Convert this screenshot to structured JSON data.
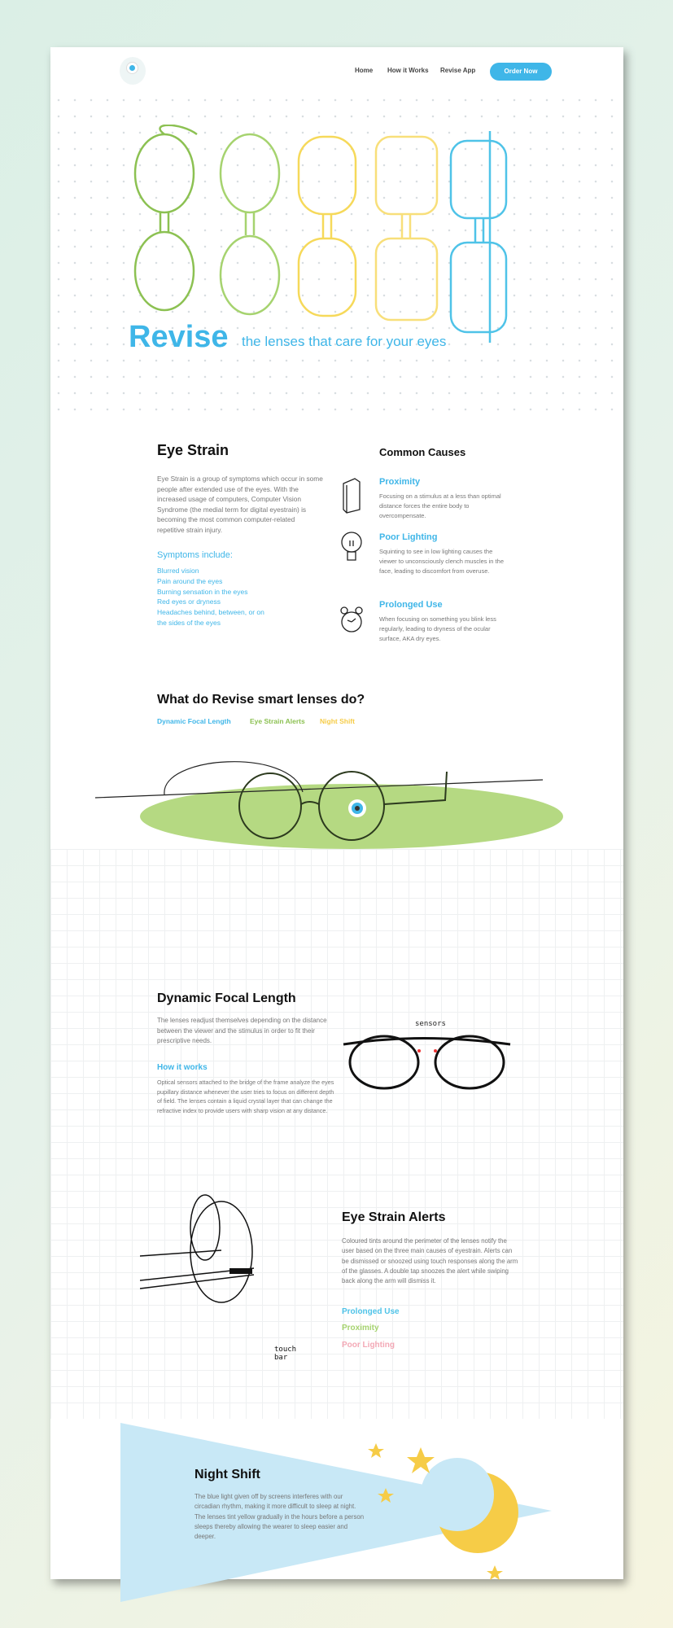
{
  "nav": {
    "links": [
      "Home",
      "How it Works",
      "Revise App"
    ],
    "order_button": "Order Now"
  },
  "colors": {
    "accent": "#3fb6e8",
    "green": "#8cc152",
    "yellow": "#f6cc47",
    "pink": "#f3a9b6",
    "night_blue": "#c8e8f6"
  },
  "hero": {
    "title": "Revise",
    "tagline": "the lenses that care for your eyes"
  },
  "eye_strain": {
    "title": "Eye Strain",
    "body": "Eye Strain is a group of symptoms which occur in some people after extended use of the eyes. With the increased usage of computers, Computer Vision Syndrome (the medial term for digital eyestrain) is becoming the most common computer-related repetitive strain injury.",
    "symptoms_title": "Symptoms include:",
    "symptoms": [
      "Blurred vision",
      "Pain around the eyes",
      "Burning sensation in the eyes",
      "Red eyes or dryness",
      "Headaches behind, between, or on the sides of the eyes"
    ]
  },
  "causes": {
    "title": "Common Causes",
    "items": [
      {
        "icon": "book-icon",
        "title": "Proximity",
        "body": "Focusing on a stimulus at a less than optimal distance forces the entire body to overcompensate."
      },
      {
        "icon": "lightbulb-icon",
        "title": "Poor Lighting",
        "body": "Squinting to see in low lighting causes the viewer to unconsciously clench muscles in the face, leading to discomfort from overuse."
      },
      {
        "icon": "alarm-clock-icon",
        "title": "Prolonged Use",
        "body": "When focusing on something you blink less regularly, leading to dryness of the ocular surface, AKA dry eyes."
      }
    ]
  },
  "features": {
    "title": "What do Revise smart lenses do?",
    "links": [
      "Dynamic Focal Length",
      "Eye Strain Alerts",
      "Night Shift"
    ]
  },
  "dfl": {
    "title": "Dynamic Focal Length",
    "body": "The lenses readjust themselves depending on the distance between the viewer and the stimulus in order to fit their prescriptive needs.",
    "how_title": "How it works",
    "how_body": "Optical sensors attached to the bridge of the frame analyze the eyes pupillary distance whenever the user tries to focus on different depth of field. The lenses contain a liquid crystal layer that can change the refractive index to provide users with sharp vision at any distance.",
    "sensor_label": "sensors"
  },
  "alerts": {
    "title": "Eye Strain Alerts",
    "body": "Coloured tints around the perimeter of the lenses notify the user based on the three main causes of eyestrain. Alerts can be dismissed or snoozed using touch responses along the arm of the glasses. A double tap snoozes the alert while swiping back along the arm will dismiss it.",
    "items": [
      "Prolonged Use",
      "Proximity",
      "Poor Lighting"
    ],
    "touch_label": "touch bar"
  },
  "night": {
    "title": "Night Shift",
    "body": "The blue light given off by screens interferes with our circadian rhythm, making it more difficult to sleep at night. The lenses tint yellow gradually in the hours before a person sleeps thereby allowing the wearer to sleep easier and deeper."
  }
}
